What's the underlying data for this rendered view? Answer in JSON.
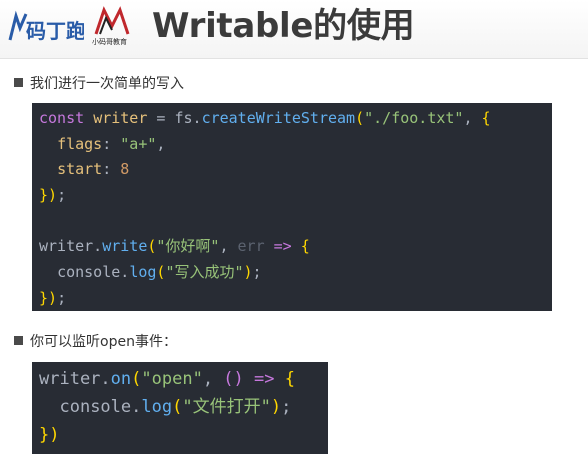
{
  "header": {
    "title": "Writable的使用",
    "logo_left_text": "码丁跑",
    "logo_right_text": "小码哥教育"
  },
  "bullets": [
    "我们进行一次简单的写入",
    "你可以监听open事件："
  ],
  "code_block_1": [
    [
      [
        "kw",
        "const "
      ],
      [
        "var",
        "writer"
      ],
      [
        "punc",
        " = "
      ],
      [
        "punc",
        "fs."
      ],
      [
        "fn",
        "createWriteStream"
      ],
      [
        "br",
        "("
      ],
      [
        "str",
        "\"./foo.txt\""
      ],
      [
        "punc",
        ", "
      ],
      [
        "br",
        "{"
      ]
    ],
    [
      [
        "guide",
        "  "
      ],
      [
        "prop",
        "flags"
      ],
      [
        "punc",
        ": "
      ],
      [
        "str",
        "\"a+\""
      ],
      [
        "punc",
        ","
      ]
    ],
    [
      [
        "guide",
        "  "
      ],
      [
        "prop",
        "start"
      ],
      [
        "punc",
        ": "
      ],
      [
        "num",
        "8"
      ]
    ],
    [
      [
        "br",
        "}"
      ],
      [
        "br",
        ")"
      ],
      [
        "punc",
        ";"
      ]
    ],
    [
      [
        "punc",
        ""
      ]
    ],
    [
      [
        "punc",
        "writer."
      ],
      [
        "fn",
        "write"
      ],
      [
        "br",
        "("
      ],
      [
        "str",
        "\"你好啊\""
      ],
      [
        "punc",
        ", "
      ],
      [
        "dim",
        "err"
      ],
      [
        "punc",
        " "
      ],
      [
        "kw",
        "=>"
      ],
      [
        "punc",
        " "
      ],
      [
        "br",
        "{"
      ]
    ],
    [
      [
        "guide",
        "  "
      ],
      [
        "punc",
        "console."
      ],
      [
        "fn",
        "log"
      ],
      [
        "br",
        "("
      ],
      [
        "str",
        "\"写入成功\""
      ],
      [
        "br",
        ")"
      ],
      [
        "punc",
        ";"
      ]
    ],
    [
      [
        "br",
        "}"
      ],
      [
        "br",
        ")"
      ],
      [
        "punc",
        ";"
      ]
    ]
  ],
  "code_block_2": [
    [
      [
        "punc",
        "writer."
      ],
      [
        "fn",
        "on"
      ],
      [
        "br",
        "("
      ],
      [
        "str",
        "\"open\""
      ],
      [
        "punc",
        ", "
      ],
      [
        "kw",
        "()"
      ],
      [
        "punc",
        " "
      ],
      [
        "kw",
        "=>"
      ],
      [
        "punc",
        " "
      ],
      [
        "br",
        "{"
      ]
    ],
    [
      [
        "guide",
        "  "
      ],
      [
        "punc",
        "console."
      ],
      [
        "fn",
        "log"
      ],
      [
        "br",
        "("
      ],
      [
        "str",
        "\"文件打开\""
      ],
      [
        "br",
        ")"
      ],
      [
        "punc",
        ";"
      ]
    ],
    [
      [
        "br",
        "}"
      ],
      [
        "br",
        ")"
      ]
    ]
  ]
}
